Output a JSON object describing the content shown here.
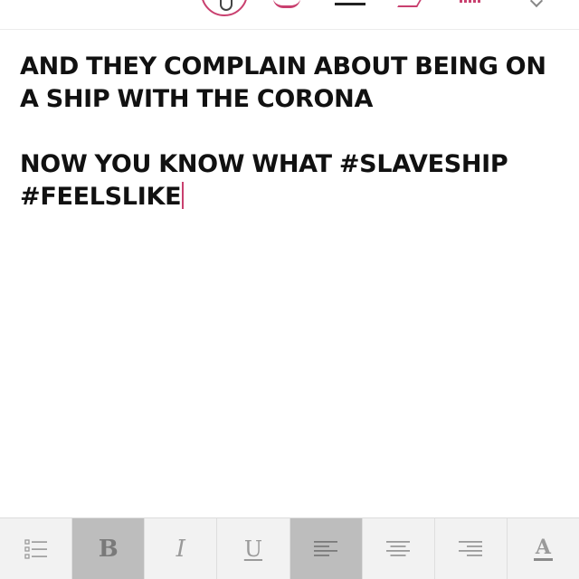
{
  "editor": {
    "paragraphs": [
      "AND THEY COMPLAIN ABOUT BEING ON A SHIP WITH THE CORONA",
      "",
      "NOW YOU KNOW WHAT #SLAVESHIP #FEELSLIKE"
    ],
    "caret_color": "#c9406f"
  },
  "format_toolbar": {
    "bold_glyph": "B",
    "italic_glyph": "I",
    "underline_glyph": "U",
    "text_color_glyph": "A",
    "buttons": [
      {
        "name": "bullet-list",
        "icon": "bullet-list-icon",
        "active": false
      },
      {
        "name": "bold",
        "icon": "bold-icon",
        "active": true
      },
      {
        "name": "italic",
        "icon": "italic-icon",
        "active": false
      },
      {
        "name": "underline",
        "icon": "underline-icon",
        "active": false
      },
      {
        "name": "align-left",
        "icon": "align-left-icon",
        "active": true
      },
      {
        "name": "align-center",
        "icon": "align-center-icon",
        "active": false
      },
      {
        "name": "align-right",
        "icon": "align-right-icon",
        "active": false
      },
      {
        "name": "text-color",
        "icon": "text-color-icon",
        "active": false
      }
    ],
    "active_bg": "#bdbdbd",
    "bar_bg": "#f2f2f2"
  },
  "top_toolbar": {
    "icons": [
      "text-style-icon",
      "brush-icon",
      "line-icon",
      "sticker-icon",
      "stats-icon",
      "done-icon"
    ],
    "accent_color": "#c9406f"
  }
}
